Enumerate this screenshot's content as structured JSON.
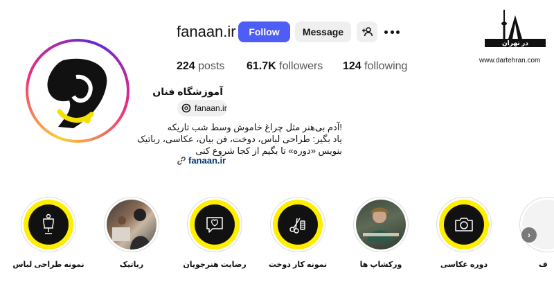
{
  "profile": {
    "username": "fanaan.ir",
    "follow_label": "Follow",
    "message_label": "Message",
    "posts_count": "224",
    "posts_label": "posts",
    "followers_count": "61.7K",
    "followers_label": "followers",
    "following_count": "124",
    "following_label": "following",
    "full_name": "آموزشگاه فنان",
    "threads_handle": "fanaan.ir",
    "bio_lines": [
      "!آدم بی‌هنر مثل چراغ خاموش وسط شب تاریکه",
      "یاد بگیر: طراحی لباس، دوخت، فن بیان، عکاسی، رباتیک",
      "بنویس «دوره» تا بگیم از کجا شروع کنی"
    ],
    "link": "fanaan.ir"
  },
  "watermark": {
    "logo_text": "در تهران",
    "url": "www.dartehran.com"
  },
  "highlights": [
    {
      "label": "نمونه طراحی لباس",
      "icon": "mannequin-icon"
    },
    {
      "label": "رباتیک",
      "icon": "photo"
    },
    {
      "label": "رضایت هنرجویان",
      "icon": "heart-chat-icon"
    },
    {
      "label": "نمونه کار دوخت",
      "icon": "sewing-tools-icon"
    },
    {
      "label": "ورکشاپ ها",
      "icon": "photo"
    },
    {
      "label": "دوره عکاسی",
      "icon": "camera-icon"
    },
    {
      "label": "ف",
      "icon": "photo"
    }
  ],
  "colors": {
    "follow_button": "#4d5df5",
    "highlight_yellow": "#ffee00",
    "link": "#00376b"
  }
}
